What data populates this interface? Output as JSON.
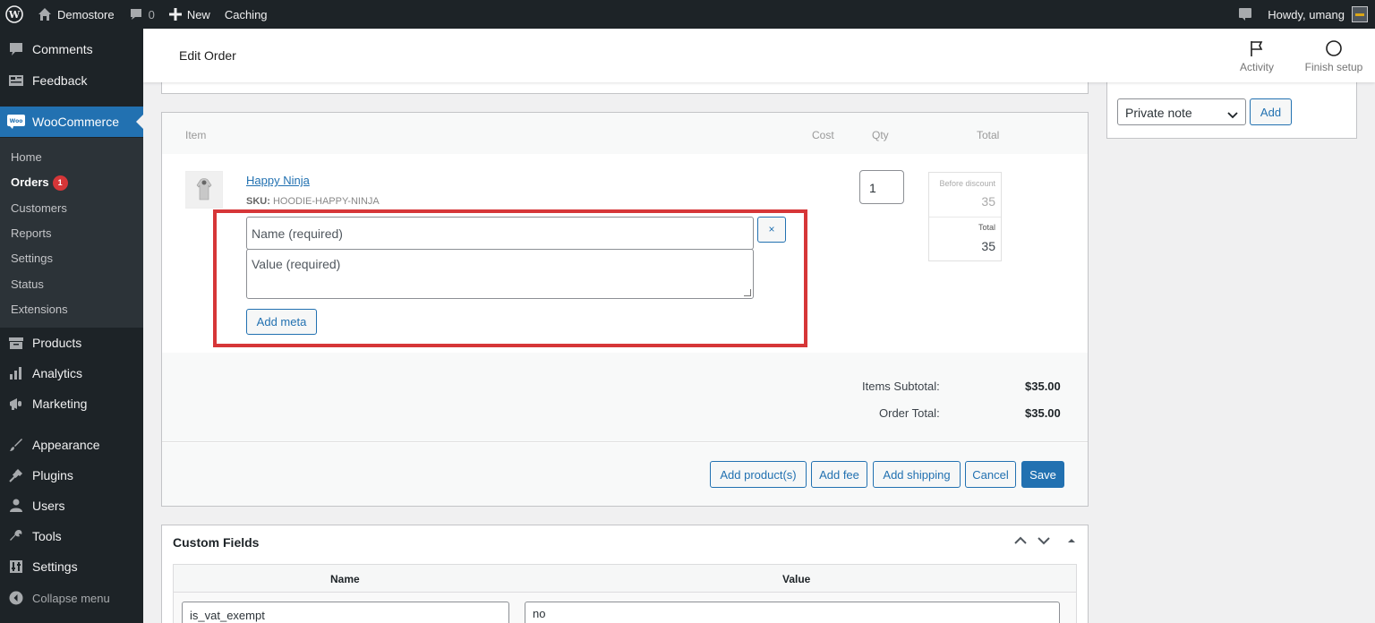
{
  "adminbar": {
    "site_name": "Demostore",
    "comments_count": "0",
    "new_label": "New",
    "caching_label": "Caching",
    "howdy": "Howdy, umang"
  },
  "sidebar": {
    "items": [
      {
        "label": "Comments",
        "icon": "comment-icon"
      },
      {
        "label": "Feedback",
        "icon": "feedback-icon"
      },
      {
        "label": "WooCommerce",
        "icon": "woo-icon"
      },
      {
        "label": "Products",
        "icon": "archive-icon"
      },
      {
        "label": "Analytics",
        "icon": "bar-chart-icon"
      },
      {
        "label": "Marketing",
        "icon": "megaphone-icon"
      },
      {
        "label": "Appearance",
        "icon": "brush-icon"
      },
      {
        "label": "Plugins",
        "icon": "plug-icon"
      },
      {
        "label": "Users",
        "icon": "user-icon"
      },
      {
        "label": "Tools",
        "icon": "wrench-icon"
      },
      {
        "label": "Settings",
        "icon": "settings-icon"
      }
    ],
    "submenu": [
      "Home",
      "Orders",
      "Customers",
      "Reports",
      "Settings",
      "Status",
      "Extensions"
    ],
    "orders_badge": "1",
    "collapse_label": "Collapse menu"
  },
  "header": {
    "title": "Edit Order",
    "activity_label": "Activity",
    "finish_setup_label": "Finish setup"
  },
  "items_table": {
    "columns": {
      "item": "Item",
      "cost": "Cost",
      "qty": "Qty",
      "total": "Total"
    },
    "product_name": "Happy Ninja",
    "sku_label": "SKU:",
    "sku_value": "HOODIE-HAPPY-NINJA",
    "qty": "1",
    "before_discount_label": "Before discount",
    "before_discount_value": "35",
    "total_label": "Total",
    "total_value": "35"
  },
  "meta_form": {
    "name_placeholder": "Name (required)",
    "value_placeholder": "Value (required)",
    "remove_label": "×",
    "add_meta_label": "Add meta"
  },
  "summary": {
    "items_subtotal_label": "Items Subtotal:",
    "items_subtotal_value": "$35.00",
    "order_total_label": "Order Total:",
    "order_total_value": "$35.00"
  },
  "actions": {
    "add_products": "Add product(s)",
    "add_fee": "Add fee",
    "add_shipping": "Add shipping",
    "cancel": "Cancel",
    "save": "Save"
  },
  "custom_fields": {
    "title": "Custom Fields",
    "name_header": "Name",
    "value_header": "Value",
    "row_name": "is_vat_exempt",
    "row_value": "no"
  },
  "notes": {
    "note_type": "Private note",
    "add_label": "Add"
  },
  "colors": {
    "accent": "#2271b1",
    "highlight": "#d63638",
    "admin_dark": "#1d2327"
  }
}
